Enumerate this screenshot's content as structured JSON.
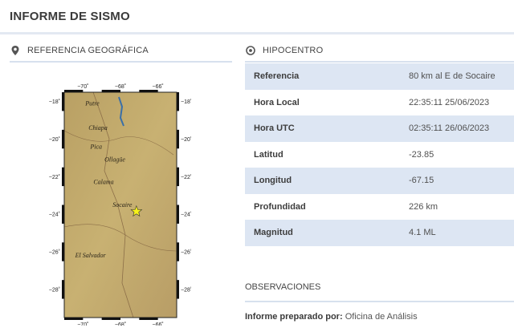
{
  "page": {
    "title": "INFORME DE SISMO"
  },
  "geo": {
    "heading": "REFERENCIA GEOGRÁFICA",
    "icon": "map-pin-icon",
    "map": {
      "lon_ticks": [
        "−70˚",
        "−68˚",
        "−66˚"
      ],
      "lat_ticks": [
        "−18˚",
        "−20˚",
        "−22˚",
        "−24˚",
        "−26˚",
        "−28˚"
      ],
      "places": [
        {
          "name": "Putre",
          "lon": -69.5,
          "lat": -18.2
        },
        {
          "name": "Chiapa",
          "lon": -69.2,
          "lat": -19.5
        },
        {
          "name": "Pica",
          "lon": -69.3,
          "lat": -20.5
        },
        {
          "name": "Ollagüe",
          "lon": -68.3,
          "lat": -21.2
        },
        {
          "name": "Calama",
          "lon": -68.9,
          "lat": -22.4
        },
        {
          "name": "Socaire",
          "lon": -67.9,
          "lat": -23.6
        },
        {
          "name": "El Salvador",
          "lon": -69.6,
          "lat": -26.3
        }
      ],
      "epicenter": {
        "lon": -67.15,
        "lat": -23.85
      }
    }
  },
  "hipo": {
    "heading": "HIPOCENTRO",
    "icon": "target-icon",
    "rows": [
      {
        "label": "Referencia",
        "value": "80 km al E de Socaire"
      },
      {
        "label": "Hora Local",
        "value": "22:35:11 25/06/2023"
      },
      {
        "label": "Hora UTC",
        "value": "02:35:11 26/06/2023"
      },
      {
        "label": "Latitud",
        "value": "-23.85"
      },
      {
        "label": "Longitud",
        "value": "-67.15"
      },
      {
        "label": "Profundidad",
        "value": "226 km"
      },
      {
        "label": "Magnitud",
        "value": "4.1 ML"
      }
    ]
  },
  "obs": {
    "heading": "OBSERVACIONES",
    "informe_label": "Informe preparado por:",
    "informe_value": "Oficina de Análisis"
  }
}
